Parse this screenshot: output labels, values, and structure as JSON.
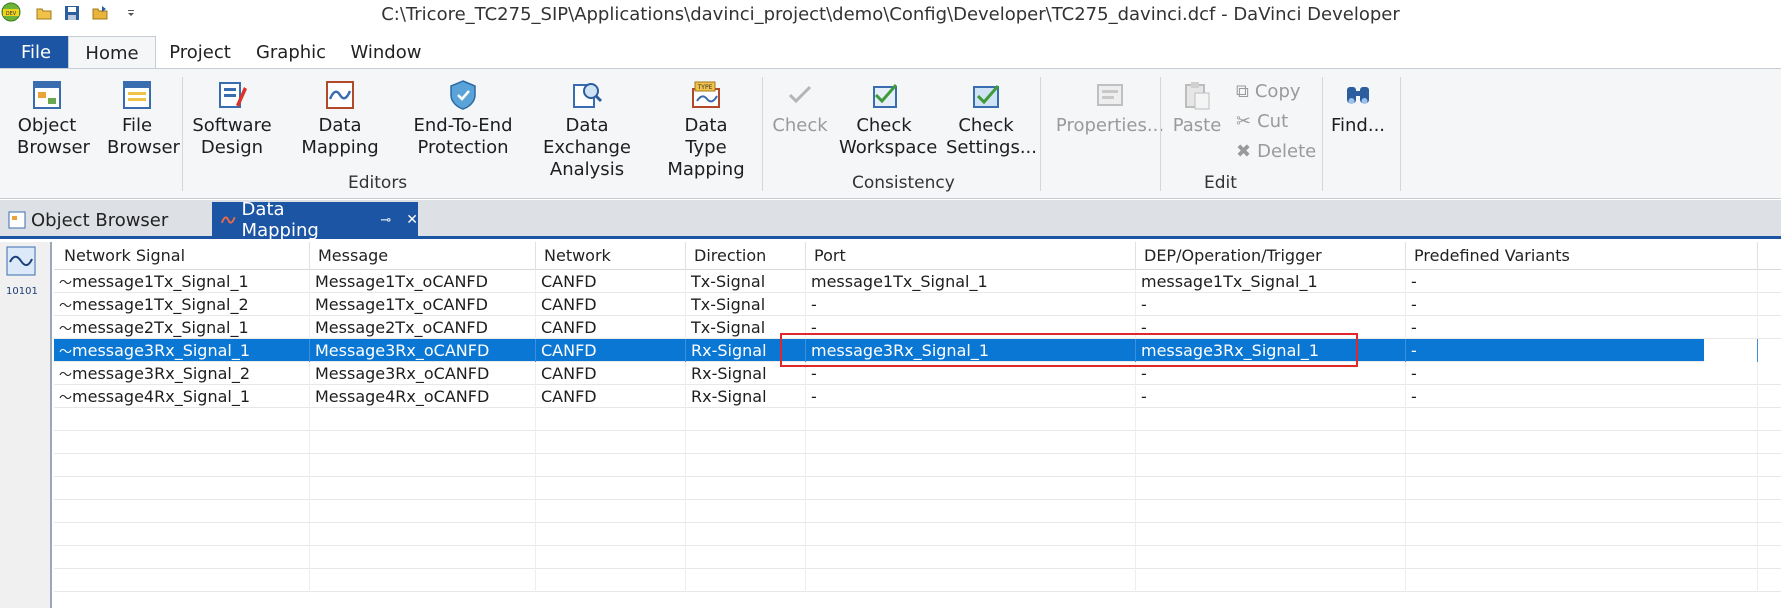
{
  "window": {
    "title": "C:\\Tricore_TC275_SIP\\Applications\\davinci_project\\demo\\Config\\Developer\\TC275_davinci.dcf - DaVinci Developer",
    "app_icon": "davinci-dev-icon",
    "quick_access": [
      "open-folder-icon",
      "save-icon",
      "open-icon",
      "customize-dropdown-icon"
    ]
  },
  "ribbon_tabs": {
    "file": "File",
    "home": "Home",
    "project": "Project",
    "graphic": "Graphic",
    "window": "Window"
  },
  "ribbon": {
    "object_browser": "Object Browser",
    "file_browser": "File Browser",
    "software_design": "Software Design",
    "data_mapping": "Data Mapping",
    "e2e_protection": "End-To-End Protection",
    "data_exchange": "Data Exchange Analysis",
    "data_type_mapping": "Data Type Mapping",
    "editors_group": "Editors",
    "check": "Check",
    "check_workspace": "Check Workspace",
    "check_settings": "Check Settings...",
    "consistency_group": "Consistency",
    "properties": "Properties...",
    "paste": "Paste",
    "copy": "Copy",
    "cut": "Cut",
    "delete": "Delete",
    "edit_group": "Edit",
    "find": "Find..."
  },
  "doc_tabs": {
    "object_browser": "Object Browser",
    "data_mapping": "Data Mapping"
  },
  "side": {
    "signal_label": "10101"
  },
  "table": {
    "columns": [
      "Network Signal",
      "Message",
      "Network",
      "Direction",
      "Port",
      "DEP/Operation/Trigger",
      "Predefined Variants"
    ],
    "rows": [
      [
        "message1Tx_Signal_1",
        "Message1Tx_oCANFD",
        "CANFD",
        "Tx-Signal",
        "message1Tx_Signal_1",
        "message1Tx_Signal_1",
        "-"
      ],
      [
        "message1Tx_Signal_2",
        "Message1Tx_oCANFD",
        "CANFD",
        "Tx-Signal",
        "-",
        "-",
        "-"
      ],
      [
        "message2Tx_Signal_1",
        "Message2Tx_oCANFD",
        "CANFD",
        "Tx-Signal",
        "-",
        "-",
        "-"
      ],
      [
        "message3Rx_Signal_1",
        "Message3Rx_oCANFD",
        "CANFD",
        "Rx-Signal",
        "message3Rx_Signal_1",
        "message3Rx_Signal_1",
        "-"
      ],
      [
        "message3Rx_Signal_2",
        "Message3Rx_oCANFD",
        "CANFD",
        "Rx-Signal",
        "-",
        "-",
        "-"
      ],
      [
        "message4Rx_Signal_1",
        "Message4Rx_oCANFD",
        "CANFD",
        "Rx-Signal",
        "-",
        "-",
        "-"
      ]
    ],
    "selected_row": 3
  },
  "colors": {
    "accent": "#1c55a4",
    "selection": "#0a77d5",
    "highlight_box": "#e0282a"
  }
}
